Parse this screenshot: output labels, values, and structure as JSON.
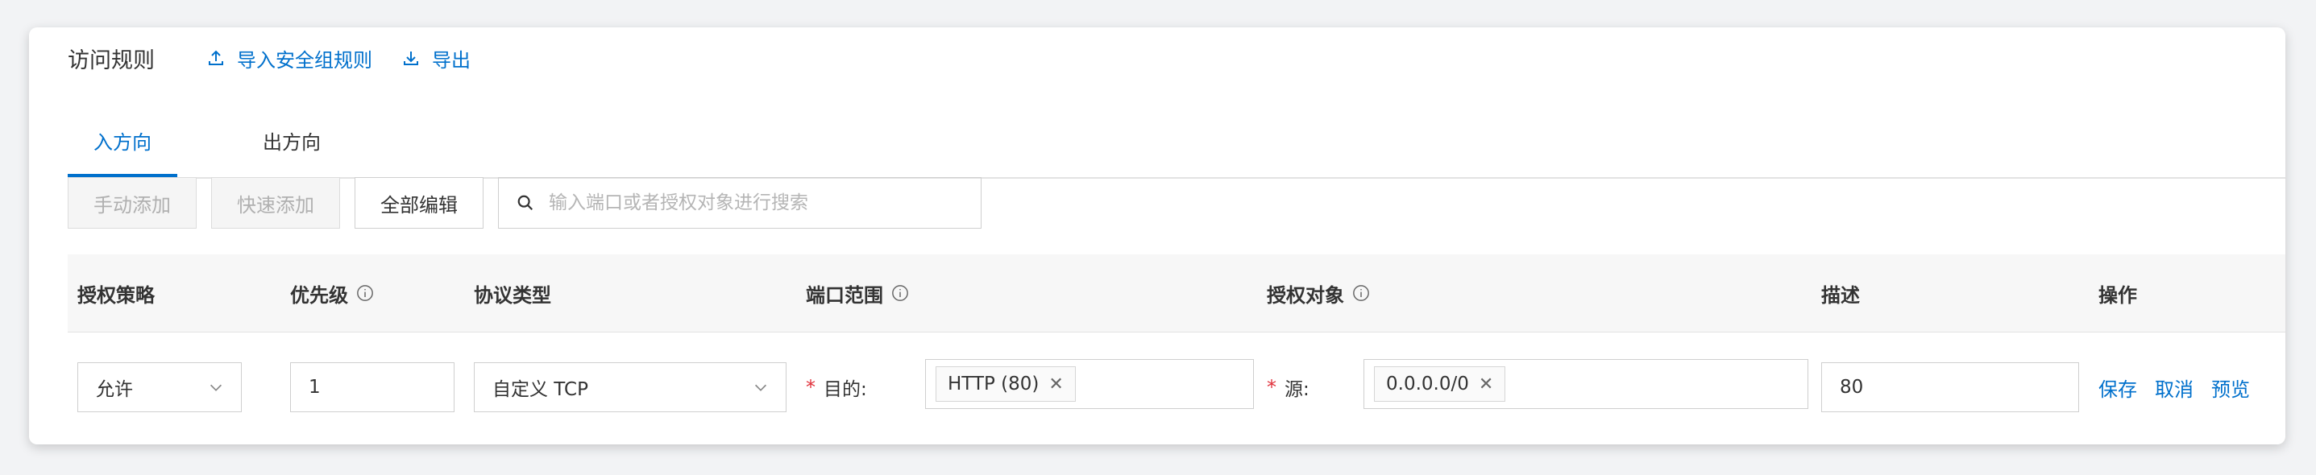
{
  "header": {
    "title": "访问规则",
    "import_label": "导入安全组规则",
    "export_label": "导出"
  },
  "tabs": [
    {
      "label": "入方向",
      "active": true
    },
    {
      "label": "出方向",
      "active": false
    }
  ],
  "toolbar": {
    "manual_add_label": "手动添加",
    "quick_add_label": "快速添加",
    "edit_all_label": "全部编辑",
    "search_placeholder": "输入端口或者授权对象进行搜索"
  },
  "table": {
    "columns": [
      "授权策略",
      "优先级",
      "协议类型",
      "端口范围",
      "授权对象",
      "描述",
      "操作"
    ],
    "rows": [
      {
        "policy": "允许",
        "priority": "1",
        "protocol": "自定义 TCP",
        "port_prefix": "目的:",
        "port_tag": "HTTP (80)",
        "source_prefix": "源:",
        "source_tag": "0.0.0.0/0",
        "description": "80",
        "actions": [
          "保存",
          "取消",
          "预览"
        ]
      }
    ]
  },
  "colors": {
    "accent": "#0070cc",
    "required": "#e0313b"
  }
}
